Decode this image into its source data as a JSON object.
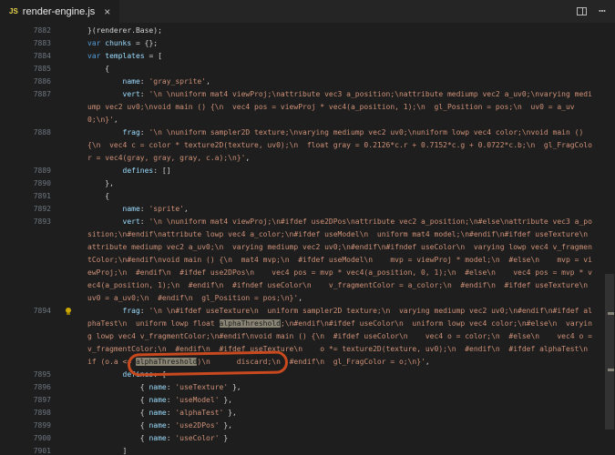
{
  "tab_bar": {
    "tab": {
      "icon": "JS",
      "title": "render-engine.js",
      "close": "×"
    },
    "actions": {
      "split_editor_icon": "split-editor",
      "more": "⋯"
    }
  },
  "annotation": {
    "shape": "hand-drawn-oval",
    "around_text": "alphaThreshold)\\n      discard;",
    "color": "#c9491e"
  },
  "colors": {
    "background": "#1e1e1e",
    "tab_bar": "#252526",
    "string": "#ce9178",
    "keyword": "#569cd6",
    "identifier": "#9cdcfe",
    "line_number": "#6e7681",
    "occurrence_highlight": "#8a8574",
    "annotation": "#c9491e",
    "lightbulb": "#cca700"
  },
  "editor": {
    "lines": [
      {
        "num": "7882",
        "tokens": [
          {
            "t": "}(renderer.Base);",
            "c": "fg"
          }
        ]
      },
      {
        "num": "7883",
        "tokens": [
          {
            "t": "var",
            "c": "kw"
          },
          {
            "t": " ",
            "c": "fg"
          },
          {
            "t": "chunks",
            "c": "var"
          },
          {
            "t": " = {};",
            "c": "fg"
          }
        ]
      },
      {
        "num": "7884",
        "tokens": [
          {
            "t": "var",
            "c": "kw"
          },
          {
            "t": " ",
            "c": "fg"
          },
          {
            "t": "templates",
            "c": "var"
          },
          {
            "t": " = [",
            "c": "fg"
          }
        ]
      },
      {
        "num": "7885",
        "tokens": [
          {
            "t": "    {",
            "c": "fg"
          }
        ]
      },
      {
        "num": "7886",
        "tokens": [
          {
            "t": "        ",
            "c": "fg"
          },
          {
            "t": "name",
            "c": "prop"
          },
          {
            "t": ": ",
            "c": "fg"
          },
          {
            "t": "'gray_sprite'",
            "c": "str"
          },
          {
            "t": ",",
            "c": "fg"
          }
        ]
      },
      {
        "num": "7887",
        "tokens": [
          {
            "t": "        ",
            "c": "fg"
          },
          {
            "t": "vert",
            "c": "prop"
          },
          {
            "t": ": ",
            "c": "fg"
          },
          {
            "t": "'\\n \\nuniform mat4 viewProj;\\nattribute vec3 a_position;\\nattribute mediump vec2 a_uv0;\\nvarying mediump vec2 uv0;\\nvoid main () {\\n  vec4 pos = viewProj * vec4(a_position, 1);\\n  gl_Position = pos;\\n  uv0 = a_uv0;\\n}'",
            "c": "str"
          },
          {
            "t": ",",
            "c": "fg"
          }
        ]
      },
      {
        "num": "7888",
        "tokens": [
          {
            "t": "        ",
            "c": "fg"
          },
          {
            "t": "frag",
            "c": "prop"
          },
          {
            "t": ": ",
            "c": "fg"
          },
          {
            "t": "'\\n \\nuniform sampler2D texture;\\nvarying mediump vec2 uv0;\\nuniform lowp vec4 color;\\nvoid main () {\\n  vec4 c = color * texture2D(texture, uv0);\\n  float gray = 0.2126*c.r + 0.7152*c.g + 0.0722*c.b;\\n  gl_FragColor = vec4(gray, gray, gray, c.a);\\n}'",
            "c": "str"
          },
          {
            "t": ",",
            "c": "fg"
          }
        ]
      },
      {
        "num": "7889",
        "tokens": [
          {
            "t": "        ",
            "c": "fg"
          },
          {
            "t": "defines",
            "c": "prop"
          },
          {
            "t": ": []",
            "c": "fg"
          }
        ]
      },
      {
        "num": "7890",
        "tokens": [
          {
            "t": "    },",
            "c": "fg"
          }
        ]
      },
      {
        "num": "7891",
        "tokens": [
          {
            "t": "    {",
            "c": "fg"
          }
        ]
      },
      {
        "num": "7892",
        "tokens": [
          {
            "t": "        ",
            "c": "fg"
          },
          {
            "t": "name",
            "c": "prop"
          },
          {
            "t": ": ",
            "c": "fg"
          },
          {
            "t": "'sprite'",
            "c": "str"
          },
          {
            "t": ",",
            "c": "fg"
          }
        ]
      },
      {
        "num": "7893",
        "tokens": [
          {
            "t": "        ",
            "c": "fg"
          },
          {
            "t": "vert",
            "c": "prop"
          },
          {
            "t": ": ",
            "c": "fg"
          },
          {
            "t": "'\\n \\nuniform mat4 viewProj;\\n#ifdef use2DPos\\nattribute vec2 a_position;\\n#else\\nattribute vec3 a_position;\\n#endif\\nattribute lowp vec4 a_color;\\n#ifdef useModel\\n  uniform mat4 model;\\n#endif\\n#ifdef useTexture\\n  attribute mediump vec2 a_uv0;\\n  varying mediump vec2 uv0;\\n#endif\\n#ifndef useColor\\n  varying lowp vec4 v_fragmentColor;\\n#endif\\nvoid main () {\\n  mat4 mvp;\\n  #ifdef useModel\\n    mvp = viewProj * model;\\n  #else\\n    mvp = viewProj;\\n  #endif\\n  #ifdef use2DPos\\n    vec4 pos = mvp * vec4(a_position, 0, 1);\\n  #else\\n    vec4 pos = mvp * vec4(a_position, 1);\\n  #endif\\n  #ifndef useColor\\n    v_fragmentColor = a_color;\\n  #endif\\n  #ifdef useTexture\\n    uv0 = a_uv0;\\n  #endif\\n  gl_Position = pos;\\n}'",
            "c": "str"
          },
          {
            "t": ",",
            "c": "fg"
          }
        ]
      },
      {
        "num": "7894",
        "lightbulb": true,
        "tokens": [
          {
            "t": "        ",
            "c": "fg"
          },
          {
            "t": "frag",
            "c": "prop"
          },
          {
            "t": ": ",
            "c": "fg"
          },
          {
            "t": "'\\n \\n#ifdef useTexture\\n  uniform sampler2D texture;\\n  varying mediump vec2 uv0;\\n#endif\\n#ifdef alphaTest\\n  uniform lowp float ",
            "c": "str"
          },
          {
            "t": "alphaThreshold",
            "c": "strhl"
          },
          {
            "t": ";\\n#endif\\n#ifdef useColor\\n  uniform lowp vec4 color;\\n#else\\n  varying lowp vec4 v_fragmentColor;\\n#endif\\nvoid main () {\\n  #ifdef useColor\\n    vec4 o = color;\\n  #else\\n    vec4 o = v_fragmentColor;\\n  #endif\\n  #ifdef useTexture\\n    o *= texture2D(texture, uv0);\\n  #endif\\n  #ifdef alphaTest\\n    if (o.a <= ",
            "c": "str"
          },
          {
            "t": "alphaThreshold",
            "c": "strhl",
            "circled": true
          },
          {
            "t": ")\\n      discard;\\n  #endif\\n  gl_FragColor = o;\\n}'",
            "c": "str"
          },
          {
            "t": ",",
            "c": "fg"
          }
        ]
      },
      {
        "num": "7895",
        "tokens": [
          {
            "t": "        ",
            "c": "fg"
          },
          {
            "t": "defines",
            "c": "prop"
          },
          {
            "t": ": [",
            "c": "fg"
          }
        ]
      },
      {
        "num": "7896",
        "tokens": [
          {
            "t": "            { ",
            "c": "fg"
          },
          {
            "t": "name",
            "c": "prop"
          },
          {
            "t": ": ",
            "c": "fg"
          },
          {
            "t": "'useTexture'",
            "c": "str"
          },
          {
            "t": " },",
            "c": "fg"
          }
        ]
      },
      {
        "num": "7897",
        "tokens": [
          {
            "t": "            { ",
            "c": "fg"
          },
          {
            "t": "name",
            "c": "prop"
          },
          {
            "t": ": ",
            "c": "fg"
          },
          {
            "t": "'useModel'",
            "c": "str"
          },
          {
            "t": " },",
            "c": "fg"
          }
        ]
      },
      {
        "num": "7898",
        "tokens": [
          {
            "t": "            { ",
            "c": "fg"
          },
          {
            "t": "name",
            "c": "prop"
          },
          {
            "t": ": ",
            "c": "fg"
          },
          {
            "t": "'alphaTest'",
            "c": "str"
          },
          {
            "t": " },",
            "c": "fg"
          }
        ]
      },
      {
        "num": "7899",
        "tokens": [
          {
            "t": "            { ",
            "c": "fg"
          },
          {
            "t": "name",
            "c": "prop"
          },
          {
            "t": ": ",
            "c": "fg"
          },
          {
            "t": "'use2DPos'",
            "c": "str"
          },
          {
            "t": " },",
            "c": "fg"
          }
        ]
      },
      {
        "num": "7900",
        "tokens": [
          {
            "t": "            { ",
            "c": "fg"
          },
          {
            "t": "name",
            "c": "prop"
          },
          {
            "t": ": ",
            "c": "fg"
          },
          {
            "t": "'useColor'",
            "c": "str"
          },
          {
            "t": " }",
            "c": "fg"
          }
        ]
      },
      {
        "num": "7901",
        "tokens": [
          {
            "t": "        ]",
            "c": "fg"
          }
        ]
      }
    ]
  }
}
